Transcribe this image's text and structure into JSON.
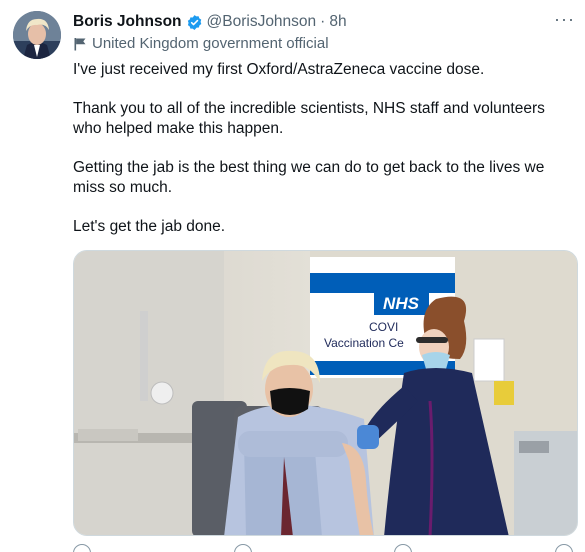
{
  "author": {
    "name": "Boris Johnson",
    "handle": "@BorisJohnson",
    "separator": "·",
    "time": "8h",
    "label": "United Kingdom government official"
  },
  "tweet": {
    "paragraphs": [
      "I've just received my first Oxford/AstraZeneca vaccine dose.",
      "Thank you to all of the incredible scientists, NHS staff and volunteers who helped make this happen.",
      "Getting the jab is the best thing we can do to get back to the lives we miss so much.",
      "Let's get the jab done."
    ]
  },
  "media": {
    "sign_logo": "NHS",
    "sign_line1": "COVI",
    "sign_line2": "Vaccination Ce"
  },
  "icons": {
    "verified": "verified-badge-icon",
    "label": "flag-icon",
    "more": "more-icon",
    "reply": "reply-icon",
    "retweet": "retweet-icon",
    "like": "like-icon",
    "share": "share-icon"
  },
  "colors": {
    "verified": "#1d9bf0",
    "text": "#0f1419",
    "secondary": "#536471",
    "nhs_blue": "#005eb8",
    "scrubs": "#1f2a5a"
  }
}
